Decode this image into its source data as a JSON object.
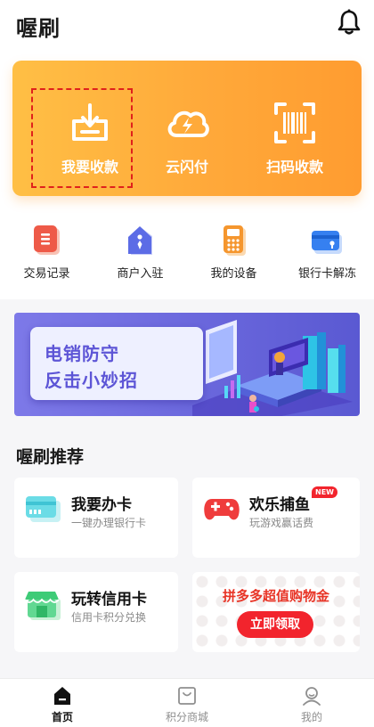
{
  "header": {
    "title": "喔刷"
  },
  "hero": [
    {
      "label": "我要收款",
      "icon": "download-box-icon"
    },
    {
      "label": "云闪付",
      "icon": "cloud-flash-icon"
    },
    {
      "label": "扫码收款",
      "icon": "scan-barcode-icon"
    }
  ],
  "quick_actions": [
    {
      "label": "交易记录",
      "icon": "record-list-icon"
    },
    {
      "label": "商户入驻",
      "icon": "merchant-house-icon"
    },
    {
      "label": "我的设备",
      "icon": "pos-device-icon"
    },
    {
      "label": "银行卡解冻",
      "icon": "bank-card-icon"
    }
  ],
  "banner": {
    "line1": "电销防守",
    "line2": "反击小妙招"
  },
  "recommend": {
    "title": "喔刷推荐",
    "cards": [
      {
        "title": "我要办卡",
        "subtitle": "一键办理银行卡",
        "icon": "credit-card-icon"
      },
      {
        "title": "欢乐捕鱼",
        "subtitle": "玩游戏赢话费",
        "icon": "gamepad-icon",
        "badge": "NEW"
      },
      {
        "title": "玩转信用卡",
        "subtitle": "信用卡积分兑换",
        "icon": "shop-icon"
      }
    ],
    "promo": {
      "title": "拼多多超值购物金",
      "button": "立即领取"
    }
  },
  "tabs": [
    {
      "label": "首页",
      "icon": "home-icon",
      "active": true
    },
    {
      "label": "积分商城",
      "icon": "points-mall-icon",
      "active": false
    },
    {
      "label": "我的",
      "icon": "profile-icon",
      "active": false
    }
  ],
  "colors": {
    "hero_orange": "#ffa93a",
    "banner_purple": "#6a67dc",
    "promo_red": "#f2242d",
    "dash_red": "#e0211c"
  }
}
